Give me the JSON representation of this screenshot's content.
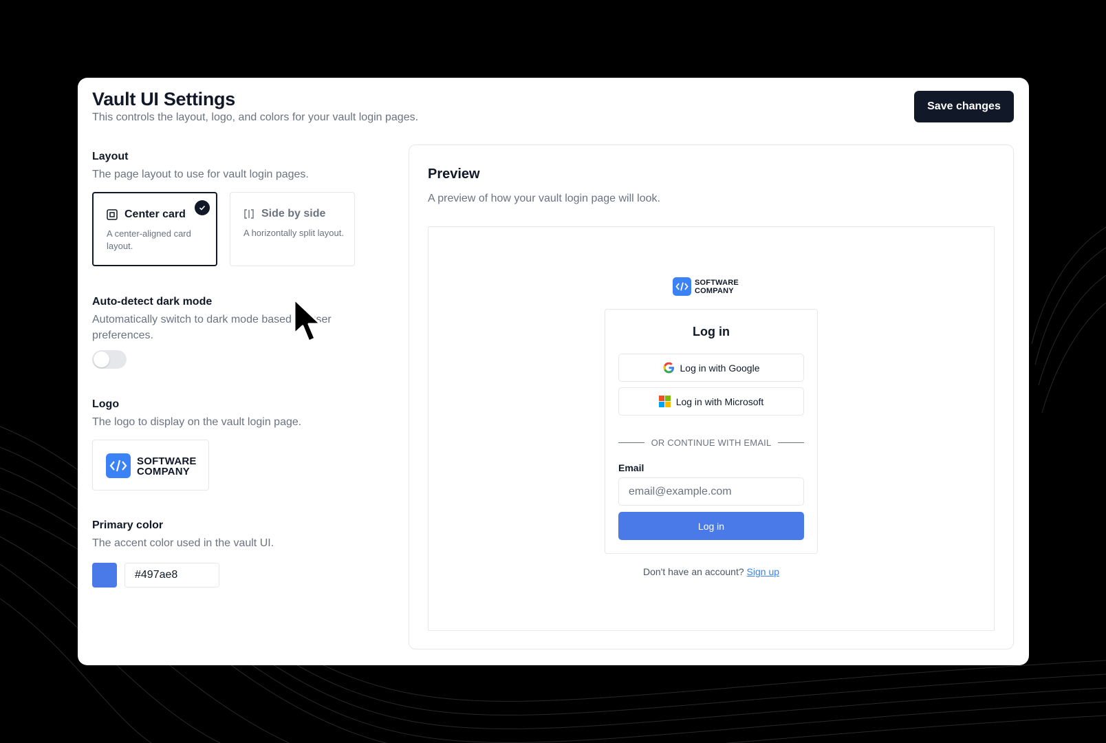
{
  "header": {
    "title": "Vault UI Settings",
    "subtitle": "This controls the layout, logo, and colors for your vault login pages.",
    "save_label": "Save changes"
  },
  "layout": {
    "label": "Layout",
    "description": "The page layout to use for vault login pages.",
    "options": [
      {
        "title": "Center card",
        "description": "A center-aligned card layout.",
        "selected": true,
        "icon": "center-card-icon"
      },
      {
        "title": "Side by side",
        "description": "A horizontally split layout.",
        "selected": false,
        "icon": "split-layout-icon"
      }
    ]
  },
  "dark_mode": {
    "label": "Auto-detect dark mode",
    "description": "Automatically switch to dark mode based on user preferences.",
    "enabled": false
  },
  "logo": {
    "label": "Logo",
    "description": "The logo to display on the vault login page.",
    "brand_line1": "SOFTWARE",
    "brand_line2": "COMPANY",
    "icon": "code-brackets-icon"
  },
  "primary_color": {
    "label": "Primary color",
    "description": "The accent color used in the vault UI.",
    "value": "#497ae8"
  },
  "preview": {
    "title": "Preview",
    "description": "A preview of how your vault login page will look.",
    "login": {
      "title": "Log in",
      "google_label": "Log in with Google",
      "microsoft_label": "Log in with Microsoft",
      "divider_text": "OR CONTINUE WITH EMAIL",
      "email_label": "Email",
      "email_placeholder": "email@example.com",
      "submit_label": "Log in",
      "signup_prompt": "Don't have an account?",
      "signup_link": "Sign up"
    }
  },
  "colors": {
    "accent": "#497ae8",
    "dark": "#111827",
    "logo_blue": "#3b82f6"
  }
}
